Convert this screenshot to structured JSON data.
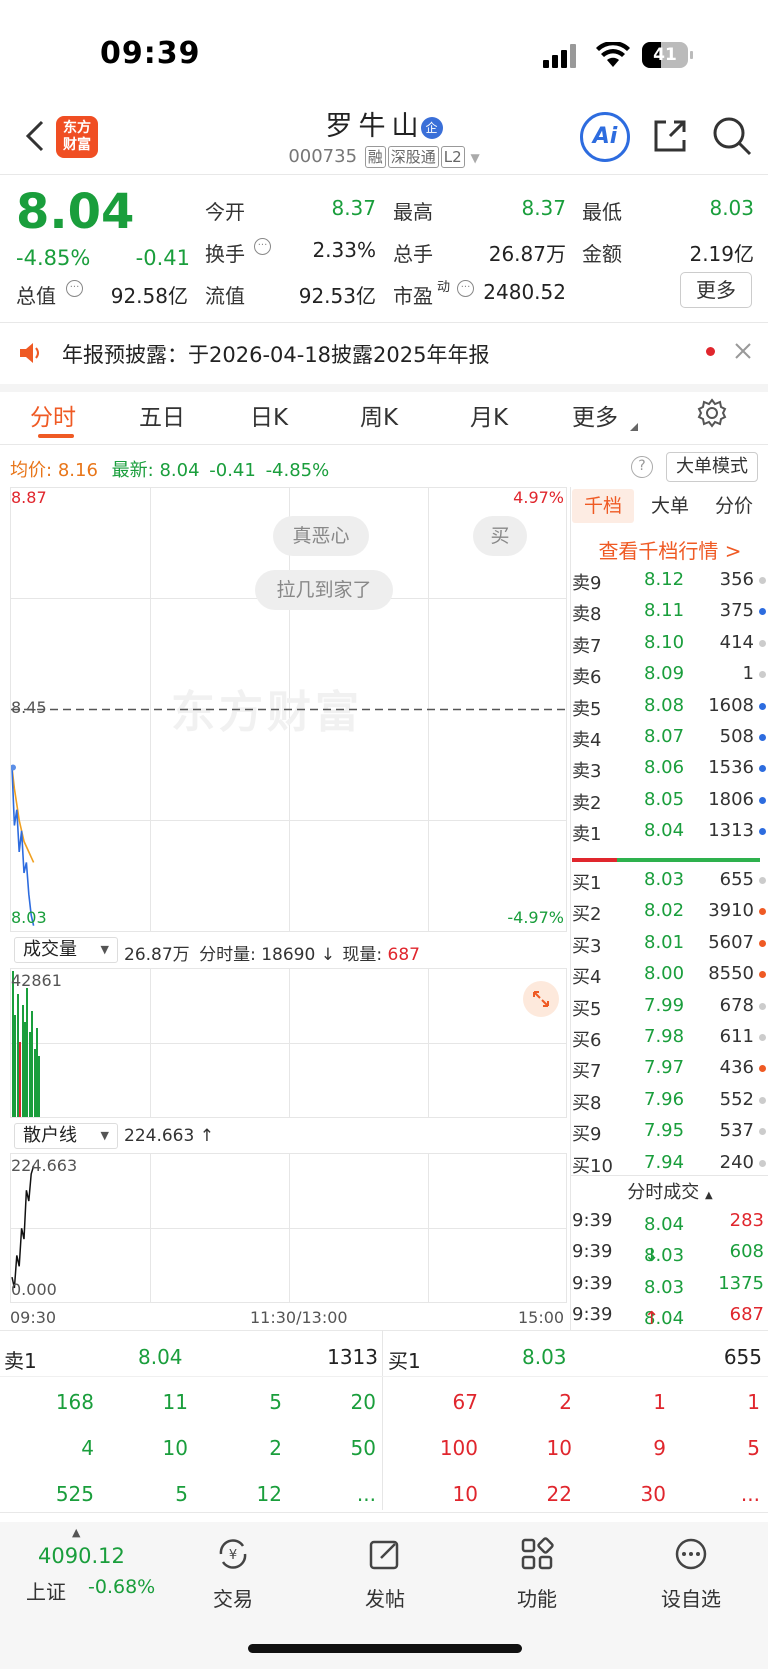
{
  "status": {
    "time": "09:39",
    "battery": "41"
  },
  "header": {
    "logo_line1": "东方",
    "logo_line2": "财富",
    "title": "罗牛山",
    "badge": "企",
    "code": "000735",
    "tags": [
      "融",
      "深股通",
      "L2"
    ],
    "ai_label": "Ai"
  },
  "quote": {
    "price": "8.04",
    "change_pct": "-4.85%",
    "change": "-0.41",
    "fields": [
      {
        "label": "今开",
        "value": "8.37",
        "color": "green"
      },
      {
        "label": "最高",
        "value": "8.37",
        "color": "green"
      },
      {
        "label": "最低",
        "value": "8.03",
        "color": "green"
      },
      {
        "label": "换手",
        "value": "2.33%",
        "color": "black"
      },
      {
        "label": "总手",
        "value": "26.87万",
        "color": "black"
      },
      {
        "label": "金额",
        "value": "2.19亿",
        "color": "black"
      },
      {
        "label": "总值",
        "value": "92.58亿",
        "color": "black"
      },
      {
        "label": "流值",
        "value": "92.53亿",
        "color": "black"
      },
      {
        "label": "市盈",
        "value": "2480.52",
        "color": "black"
      }
    ],
    "pe_superscript": "动",
    "more_button": "更多"
  },
  "notice": {
    "text": "年报预披露：于2026-04-18披露2025年年报"
  },
  "tabs": [
    "分时",
    "五日",
    "日K",
    "周K",
    "月K",
    "更多"
  ],
  "chart_info": {
    "avg_label": "均价:",
    "avg_value": "8.16",
    "latest_label": "最新:",
    "latest_value": "8.04",
    "latest_change": "-0.41",
    "latest_pct": "-4.85%",
    "big_order_button": "大单模式"
  },
  "chart_data": {
    "type": "line",
    "y_top": "8.87",
    "y_mid": "8.45",
    "y_bottom": "8.03",
    "pct_top": "4.97%",
    "pct_bottom": "-4.97%",
    "ylim": [
      8.03,
      8.87
    ],
    "reference_price": 8.45,
    "watermark": "东方财富",
    "x_labels": [
      "09:30",
      "11:30/13:00",
      "15:00"
    ],
    "price_series": [
      8.34,
      8.23,
      8.26,
      8.18,
      8.22,
      8.14,
      8.16,
      8.1,
      8.06,
      8.04
    ],
    "avg_series": [
      8.34,
      8.3,
      8.27,
      8.24,
      8.22,
      8.2,
      8.19,
      8.18,
      8.17,
      8.16
    ],
    "volume_max": "42861",
    "volume_series": [
      42861,
      30000,
      36000,
      22000,
      33000,
      28000,
      38000,
      25000,
      31000,
      20000,
      26000,
      18000
    ],
    "sanhu_max": "224.663",
    "sanhu_min": "0.000",
    "sanhu_series": [
      20,
      0,
      60,
      40,
      110,
      90,
      180,
      160,
      210,
      224.663
    ]
  },
  "danmaku": [
    "真恶心",
    "买",
    "拉几到家了"
  ],
  "volume_panel": {
    "dropdown": "成交量",
    "total": "26.87万",
    "fenshi_label": "分时量:",
    "fenshi_value": "18690",
    "current_label": "现量:",
    "current_value": "687"
  },
  "sanhu_panel": {
    "dropdown": "散户线",
    "value": "224.663"
  },
  "orderbook": {
    "tabs": [
      "千档",
      "大单",
      "分价"
    ],
    "view_link": "查看千档行情 >",
    "asks": [
      {
        "label": "卖9",
        "price": "8.12",
        "vol": "356",
        "dot": "gray"
      },
      {
        "label": "卖8",
        "price": "8.11",
        "vol": "375",
        "dot": "blue"
      },
      {
        "label": "卖7",
        "price": "8.10",
        "vol": "414",
        "dot": "gray"
      },
      {
        "label": "卖6",
        "price": "8.09",
        "vol": "1",
        "dot": "gray"
      },
      {
        "label": "卖5",
        "price": "8.08",
        "vol": "1608",
        "dot": "blue"
      },
      {
        "label": "卖4",
        "price": "8.07",
        "vol": "508",
        "dot": "blue"
      },
      {
        "label": "卖3",
        "price": "8.06",
        "vol": "1536",
        "dot": "blue"
      },
      {
        "label": "卖2",
        "price": "8.05",
        "vol": "1806",
        "dot": "blue"
      },
      {
        "label": "卖1",
        "price": "8.04",
        "vol": "1313",
        "dot": "blue"
      }
    ],
    "bids": [
      {
        "label": "买1",
        "price": "8.03",
        "vol": "655",
        "dot": "gray"
      },
      {
        "label": "买2",
        "price": "8.02",
        "vol": "3910",
        "dot": "orange"
      },
      {
        "label": "买3",
        "price": "8.01",
        "vol": "5607",
        "dot": "orange"
      },
      {
        "label": "买4",
        "price": "8.00",
        "vol": "8550",
        "dot": "orange"
      },
      {
        "label": "买5",
        "price": "7.99",
        "vol": "678",
        "dot": "gray"
      },
      {
        "label": "买6",
        "price": "7.98",
        "vol": "611",
        "dot": "gray"
      },
      {
        "label": "买7",
        "price": "7.97",
        "vol": "436",
        "dot": "orange"
      },
      {
        "label": "买8",
        "price": "7.96",
        "vol": "552",
        "dot": "gray"
      },
      {
        "label": "买9",
        "price": "7.95",
        "vol": "537",
        "dot": "gray"
      },
      {
        "label": "买10",
        "price": "7.94",
        "vol": "240",
        "dot": "gray"
      }
    ],
    "ticks_title": "分时成交",
    "ticks": [
      {
        "time": "9:39",
        "price": "8.04",
        "arrow": "",
        "vol": "283"
      },
      {
        "time": "9:39",
        "price": "8.03",
        "arrow": "↓",
        "vol": "608"
      },
      {
        "time": "9:39",
        "price": "8.03",
        "arrow": "",
        "vol": "1375"
      },
      {
        "time": "9:39",
        "price": "8.04",
        "arrow": "↑",
        "vol": "687"
      }
    ]
  },
  "queue": {
    "sell_label": "卖1",
    "sell_price": "8.04",
    "sell_vol": "1313",
    "buy_label": "买1",
    "buy_price": "8.03",
    "buy_vol": "655",
    "sell_rows": [
      [
        "168",
        "11",
        "5",
        "20"
      ],
      [
        "4",
        "10",
        "2",
        "50"
      ],
      [
        "525",
        "5",
        "12",
        "..."
      ]
    ],
    "buy_rows": [
      [
        "67",
        "2",
        "1",
        "1"
      ],
      [
        "100",
        "10",
        "9",
        "5"
      ],
      [
        "10",
        "22",
        "30",
        "..."
      ]
    ]
  },
  "bottom_nav": {
    "index_value": "4090.12",
    "index_name": "上证",
    "index_change": "-0.68%",
    "items": [
      "交易",
      "发帖",
      "功能",
      "设自选"
    ]
  }
}
